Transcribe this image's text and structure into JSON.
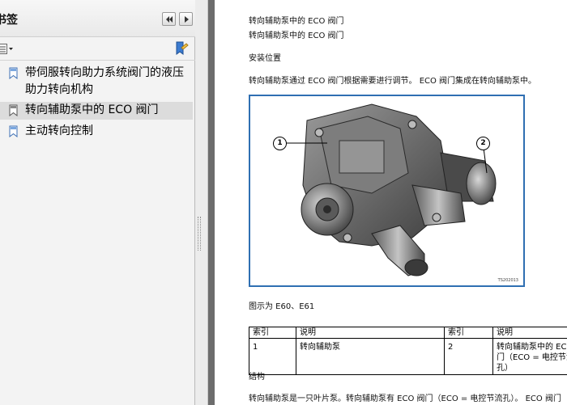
{
  "panel": {
    "title": "书签",
    "bookmarks": [
      {
        "label": "带伺服转向助力系统阀门的液压助力转向机构"
      },
      {
        "label": "转向辅助泵中的 ECO 阀门"
      },
      {
        "label": "主动转向控制"
      }
    ]
  },
  "document": {
    "heading_line_1": "转向辅助泵中的 ECO 阀门",
    "heading_line_2": "转向辅助泵中的 ECO 阀门",
    "section_install": "安装位置",
    "install_text": "转向辅助泵通过 ECO 阀门根据需要进行调节。 ECO 阀门集成在转向辅助泵中。",
    "figure": {
      "callout_1": "1",
      "callout_2": "2",
      "code": "TS202013"
    },
    "caption": "图示为 E60、E61",
    "table": {
      "headers": [
        "索引",
        "说明",
        "索引",
        "说明"
      ],
      "rows": [
        [
          "1",
          "转向辅助泵",
          "2",
          "转向辅助泵中的 ECO 阀门（ECO = 电控节流孔）"
        ]
      ]
    },
    "section_structure": "结构",
    "structure_text": "转向辅助泵是一只叶片泵。转向辅助泵有 ECO 阀门（ECO = 电控节流孔）。 ECO 阀门"
  },
  "colors": {
    "panel_bg": "#f3f3f3",
    "selected_bg": "#dcdcdc",
    "figure_border": "#2f6fb2",
    "gap": "#6d6d6d"
  }
}
